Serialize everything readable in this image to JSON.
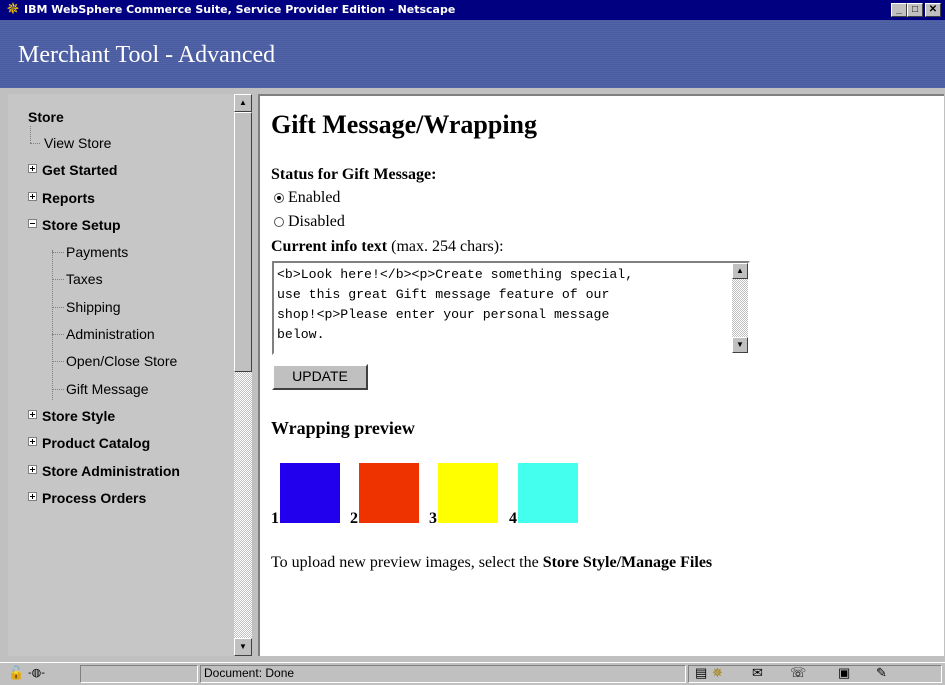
{
  "window": {
    "title": "IBM WebSphere Commerce Suite, Service Provider Edition - Netscape",
    "app_icon": "netscape-star-icon"
  },
  "header": {
    "title": "Merchant Tool - Advanced",
    "accent_color": "#4a5ba0"
  },
  "nav": {
    "root": "Store",
    "items": [
      {
        "label": "View Store",
        "type": "leaf"
      },
      {
        "label": "Get Started",
        "type": "collapsed"
      },
      {
        "label": "Reports",
        "type": "collapsed"
      },
      {
        "label": "Store Setup",
        "type": "expanded"
      },
      {
        "label": "Payments",
        "type": "child"
      },
      {
        "label": "Taxes",
        "type": "child"
      },
      {
        "label": "Shipping",
        "type": "child"
      },
      {
        "label": "Administration",
        "type": "child"
      },
      {
        "label": "Open/Close Store",
        "type": "child"
      },
      {
        "label": "Gift Message",
        "type": "child"
      },
      {
        "label": "Store Style",
        "type": "collapsed"
      },
      {
        "label": "Product Catalog",
        "type": "collapsed"
      },
      {
        "label": "Store Administration",
        "type": "collapsed"
      },
      {
        "label": "Process Orders",
        "type": "collapsed"
      }
    ]
  },
  "main": {
    "title": "Gift Message/Wrapping",
    "status_label": "Status for Gift Message:",
    "options": [
      {
        "label": "Enabled",
        "selected": true
      },
      {
        "label": "Disabled",
        "selected": false
      }
    ],
    "info_label_bold": "Current info text",
    "info_label_rest": " (max. 254 chars):",
    "info_text": "<b>Look here!</b><p>Create something special,\nuse this great Gift message feature of our\nshop!<p>Please enter your personal message\nbelow.",
    "update_label": "UPDATE",
    "wrapping_title": "Wrapping preview",
    "swatches": [
      {
        "number": "1",
        "color": "#2200ee"
      },
      {
        "number": "2",
        "color": "#ee3300"
      },
      {
        "number": "3",
        "color": "#ffff00"
      },
      {
        "number": "4",
        "color": "#44ffee"
      }
    ],
    "upload_text": "To upload new preview images, select the ",
    "upload_bold": "Store Style/Manage Files"
  },
  "statusbar": {
    "text": "Document: Done"
  }
}
